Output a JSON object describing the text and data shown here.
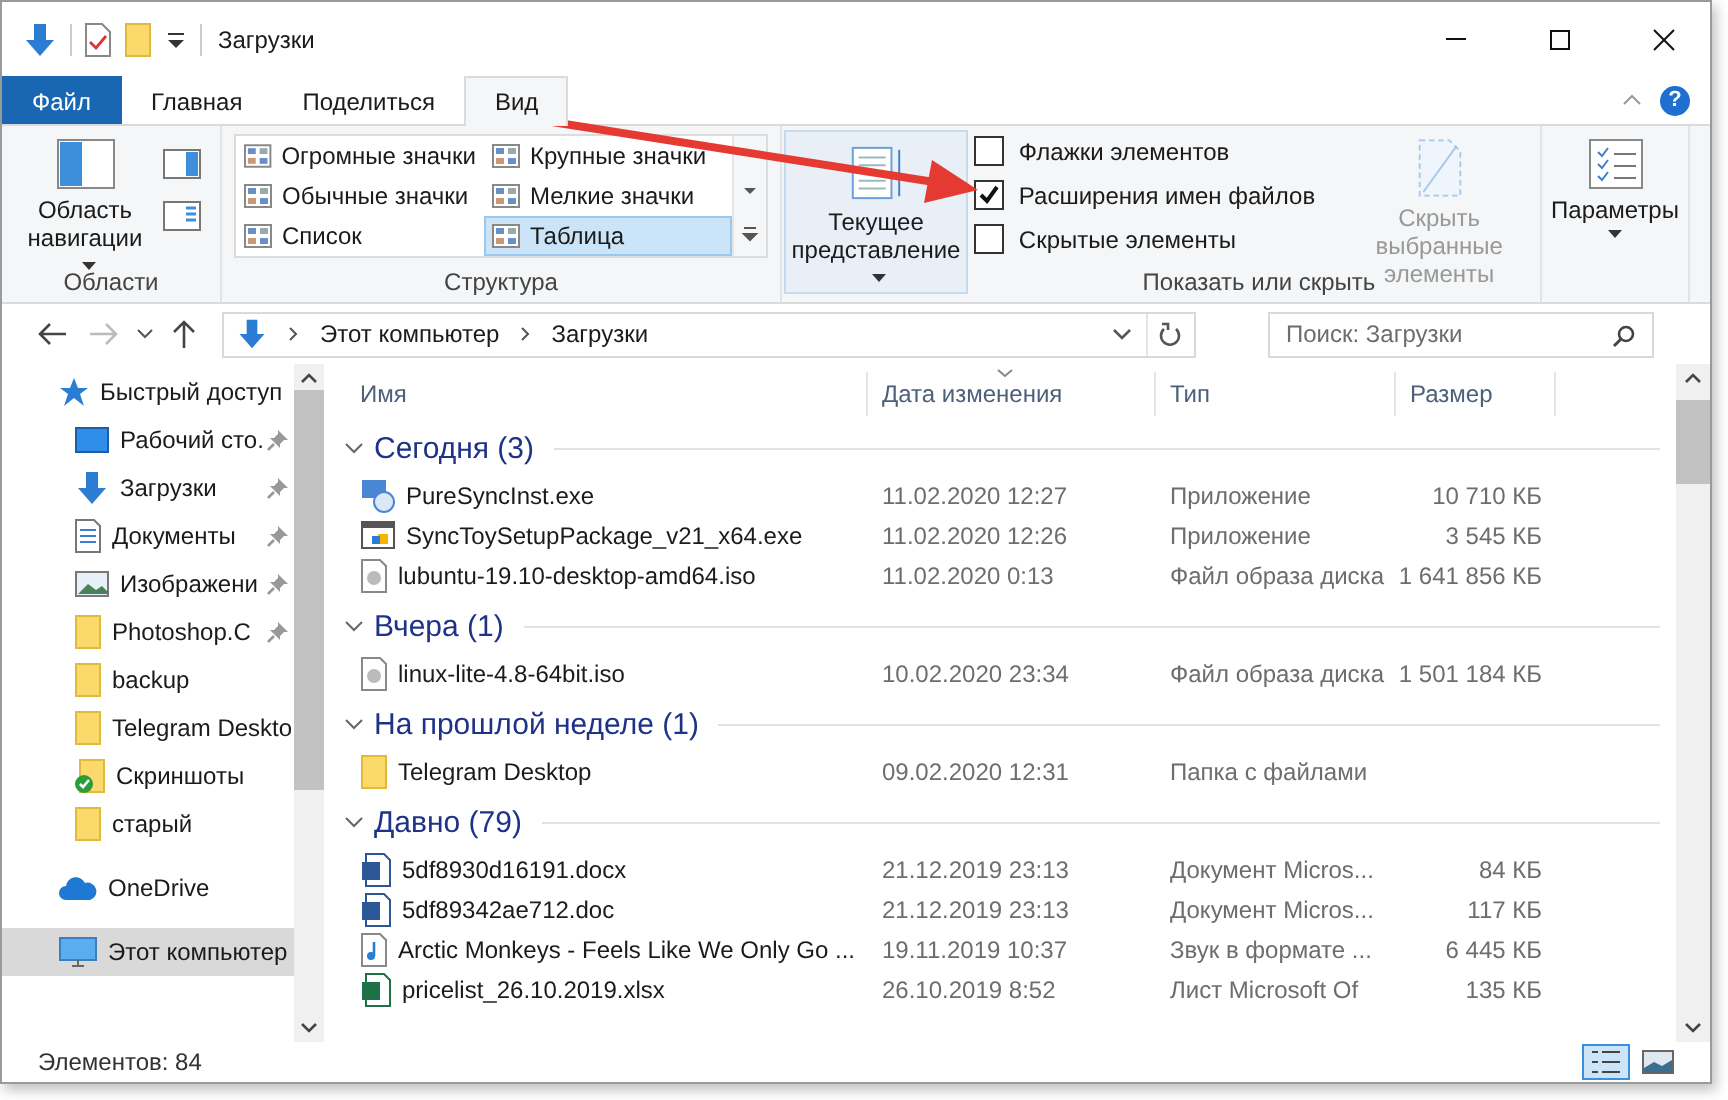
{
  "window": {
    "title": "Загрузки"
  },
  "ribbon_tabs": [
    {
      "label": "Файл",
      "kind": "file",
      "selected": false
    },
    {
      "label": "Главная",
      "kind": "tab",
      "selected": false
    },
    {
      "label": "Поделиться",
      "kind": "tab",
      "selected": false
    },
    {
      "label": "Вид",
      "kind": "tab",
      "selected": true
    }
  ],
  "help": "?",
  "ribbon": {
    "panes": {
      "button": "Область навигации",
      "label": "Области"
    },
    "layout": {
      "label": "Структура",
      "items": [
        {
          "label": "Огромные значки",
          "selected": false
        },
        {
          "label": "Крупные значки",
          "selected": false
        },
        {
          "label": "Обычные значки",
          "selected": false
        },
        {
          "label": "Мелкие значки",
          "selected": false
        },
        {
          "label": "Список",
          "selected": false
        },
        {
          "label": "Таблица",
          "selected": true
        }
      ]
    },
    "current_view": {
      "label": "Текущее представление"
    },
    "show_hide": {
      "label": "Показать или скрыть",
      "options": [
        {
          "label": "Флажки элементов",
          "checked": false
        },
        {
          "label": "Расширения имен файлов",
          "checked": true
        },
        {
          "label": "Скрытые элементы",
          "checked": false
        }
      ],
      "hide_selected": {
        "label": "Скрыть выбранные элементы",
        "disabled": true
      }
    },
    "options": {
      "label": "Параметры"
    }
  },
  "address": {
    "path": [
      "Этот компьютер",
      "Загрузки"
    ]
  },
  "search": {
    "placeholder": "Поиск: Загрузки"
  },
  "sidebar": {
    "items": [
      {
        "label": "Быстрый доступ",
        "kind": "star",
        "selected": false,
        "children": [
          {
            "label": "Рабочий сто.",
            "kind": "desktop",
            "pinned": true,
            "selected": false
          },
          {
            "label": "Загрузки",
            "kind": "downloads",
            "pinned": true,
            "selected": false
          },
          {
            "label": "Документы",
            "kind": "documents",
            "pinned": true,
            "selected": false
          },
          {
            "label": "Изображени",
            "kind": "pictures",
            "pinned": true,
            "selected": false
          },
          {
            "label": "Photoshop.C",
            "kind": "folder",
            "pinned": true,
            "selected": false
          },
          {
            "label": "backup",
            "kind": "folder",
            "pinned": false,
            "selected": false
          },
          {
            "label": "Telegram Deskto",
            "kind": "folder",
            "pinned": false,
            "selected": false
          },
          {
            "label": "Скриншоты",
            "kind": "synced",
            "pinned": false,
            "selected": false
          },
          {
            "label": "старый",
            "kind": "folder",
            "pinned": false,
            "selected": false
          }
        ]
      },
      {
        "label": "OneDrive",
        "kind": "cloud",
        "selected": false
      },
      {
        "label": "Этот компьютер",
        "kind": "computer",
        "selected": true
      }
    ]
  },
  "columns": [
    "Имя",
    "Дата изменения",
    "Тип",
    "Размер"
  ],
  "groups": [
    {
      "title": "Сегодня (3)",
      "files": [
        {
          "name": "PureSyncInst.exe",
          "kind": "app",
          "date": "11.02.2020 12:27",
          "type": "Приложение",
          "size": "10 710 КБ"
        },
        {
          "name": "SyncToySetupPackage_v21_x64.exe",
          "kind": "installer",
          "date": "11.02.2020 12:26",
          "type": "Приложение",
          "size": "3 545 КБ"
        },
        {
          "name": "lubuntu-19.10-desktop-amd64.iso",
          "kind": "disc",
          "date": "11.02.2020 0:13",
          "type": "Файл образа диска",
          "size": "1 641 856 КБ"
        }
      ]
    },
    {
      "title": "Вчера (1)",
      "files": [
        {
          "name": "linux-lite-4.8-64bit.iso",
          "kind": "disc",
          "date": "10.02.2020 23:34",
          "type": "Файл образа диска",
          "size": "1 501 184 КБ"
        }
      ]
    },
    {
      "title": "На прошлой неделе (1)",
      "files": [
        {
          "name": "Telegram Desktop",
          "kind": "folder",
          "date": "09.02.2020 12:31",
          "type": "Папка с файлами"
        }
      ]
    },
    {
      "title": "Давно (79)",
      "files": [
        {
          "name": "5df8930d16191.docx",
          "kind": "word",
          "date": "21.12.2019 23:13",
          "type": "Документ Micros...",
          "size": "84 КБ"
        },
        {
          "name": "5df89342ae712.doc",
          "kind": "word",
          "date": "21.12.2019 23:13",
          "type": "Документ Micros...",
          "size": "117 КБ"
        },
        {
          "name": "Arctic Monkeys - Feels Like We Only Go ...",
          "kind": "audio",
          "date": "19.11.2019 10:37",
          "type": "Звук в формате ...",
          "size": "6 445 КБ"
        },
        {
          "name": "pricelist_26.10.2019.xlsx",
          "kind": "excel",
          "date": "26.10.2019 8:52",
          "type": "Лист Microsoft Of",
          "size": "135 КБ"
        }
      ]
    }
  ],
  "status_bar": {
    "count": "Элементов: 84"
  },
  "view_buttons": [
    {
      "kind": "details",
      "selected": true
    },
    {
      "kind": "tiles",
      "selected": false
    }
  ]
}
